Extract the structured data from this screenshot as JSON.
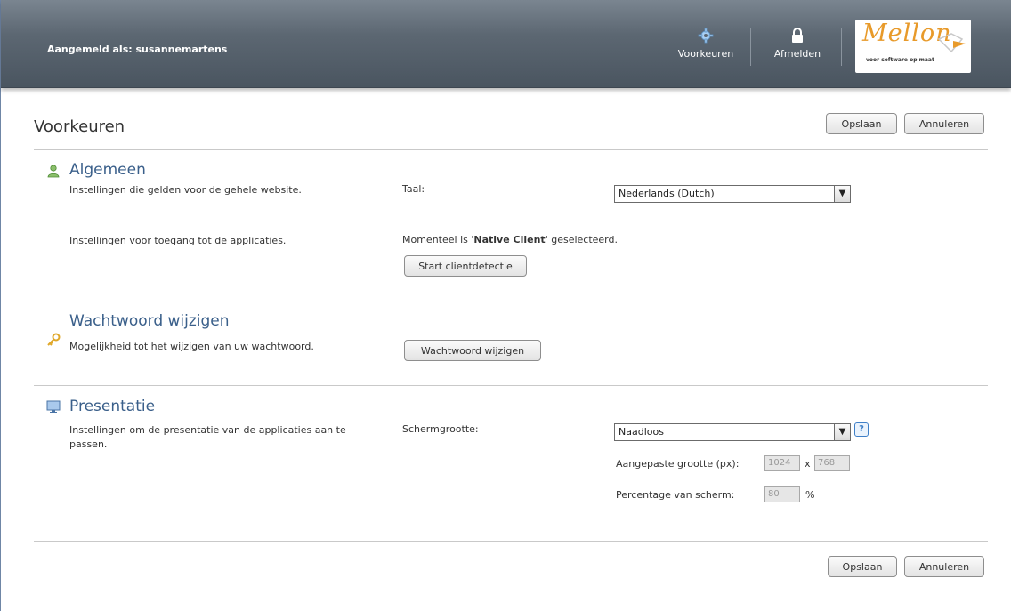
{
  "header": {
    "user_label": "Aangemeld als: susannemartens",
    "preferences_label": "Voorkeuren",
    "logout_label": "Afmelden",
    "logo_name": "Mellon",
    "logo_tagline": "voor software op maat"
  },
  "page": {
    "title": "Voorkeuren",
    "save_label": "Opslaan",
    "cancel_label": "Annuleren"
  },
  "sections": {
    "general": {
      "title": "Algemeen",
      "description": "Instellingen die gelden voor de gehele website.",
      "language_label": "Taal:",
      "language_value": "Nederlands (Dutch)",
      "access_description": "Instellingen voor toegang tot de applicaties.",
      "client_prefix": "Momenteel is '",
      "client_name": "Native Client",
      "client_suffix": "' geselecteerd.",
      "detect_button": "Start clientdetectie"
    },
    "password": {
      "title": "Wachtwoord wijzigen",
      "description": "Mogelijkheid tot het wijzigen van uw wachtwoord.",
      "change_button": "Wachtwoord wijzigen"
    },
    "presentation": {
      "title": "Presentatie",
      "description": "Instellingen om de presentatie van de applicaties aan te passen.",
      "screen_size_label": "Schermgrootte:",
      "screen_size_value": "Naadloos",
      "custom_size_label": "Aangepaste grootte (px):",
      "width_value": "1024",
      "size_separator": "x",
      "height_value": "768",
      "percentage_label": "Percentage van scherm:",
      "percentage_value": "80",
      "percent_sign": "%"
    }
  },
  "colors": {
    "header_bg": "#5c6772",
    "section_title": "#3a5f8a",
    "logo_orange": "#e89a2a"
  }
}
